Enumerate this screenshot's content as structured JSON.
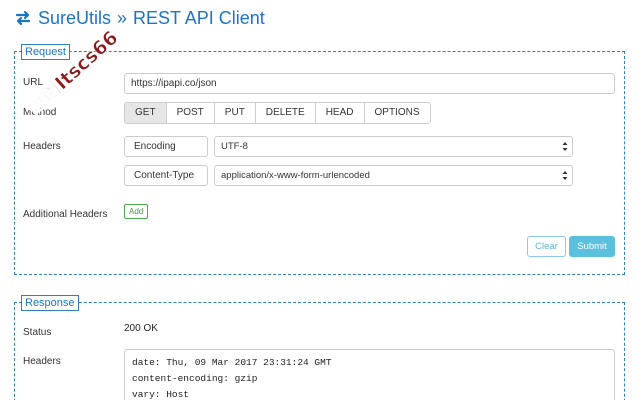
{
  "header": {
    "app_name": "SureUtils",
    "separator": "»",
    "page_title": "REST API Client",
    "brand_color": "#1b74c8"
  },
  "request": {
    "legend": "Request",
    "url_label": "URL",
    "url_value": "https://ipapi.co/json",
    "method_label": "Method",
    "methods": [
      "GET",
      "POST",
      "PUT",
      "DELETE",
      "HEAD",
      "OPTIONS"
    ],
    "selected_method": "GET",
    "headers_label": "Headers",
    "headers": [
      {
        "name": "Encoding",
        "value": "UTF-8"
      },
      {
        "name": "Content-Type",
        "value": "application/x-www-form-urlencoded"
      }
    ],
    "additional_headers_label": "Additional Headers",
    "add_label": "Add",
    "clear_label": "Clear",
    "submit_label": "Submit"
  },
  "response": {
    "legend": "Response",
    "status_label": "Status",
    "status_value": "200 OK",
    "headers_label": "Headers",
    "header_lines": [
      "date: Thu, 09 Mar 2017 23:31:24 GMT",
      "content-encoding: gzip",
      "vary: Host"
    ]
  },
  "watermark": {
    "text": "数创Itscs66",
    "color": "#8b1a1a"
  }
}
